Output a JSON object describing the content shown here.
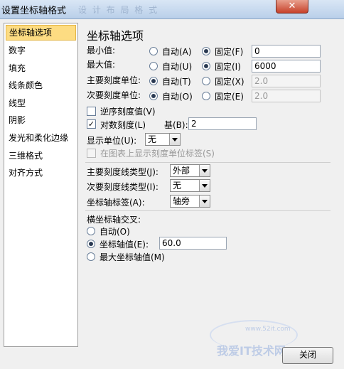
{
  "window": {
    "title": "设置坐标轴格式",
    "ghost_text": "设 计   布 局   格 式"
  },
  "sidebar": {
    "items": [
      {
        "label": "坐标轴选项",
        "selected": true
      },
      {
        "label": "数字"
      },
      {
        "label": "填充"
      },
      {
        "label": "线条颜色"
      },
      {
        "label": "线型"
      },
      {
        "label": "阴影"
      },
      {
        "label": "发光和柔化边缘"
      },
      {
        "label": "三维格式"
      },
      {
        "label": "对齐方式"
      }
    ]
  },
  "panel": {
    "heading": "坐标轴选项",
    "min": {
      "label": "最小值:",
      "auto": "自动(A)",
      "fixed": "固定(F)",
      "value": "0"
    },
    "max": {
      "label": "最大值:",
      "auto": "自动(U)",
      "fixed": "固定(I)",
      "value": "6000"
    },
    "major": {
      "label": "主要刻度单位:",
      "auto": "自动(T)",
      "fixed": "固定(X)",
      "value": "2.0"
    },
    "minor": {
      "label": "次要刻度单位:",
      "auto": "自动(O)",
      "fixed": "固定(E)",
      "value": "2.0"
    },
    "reverse": {
      "label": "逆序刻度值(V)",
      "checked": false
    },
    "log": {
      "label": "对数刻度(L)",
      "checked": true,
      "base_label": "基(B):",
      "base_value": "2"
    },
    "display_units": {
      "label": "显示单位(U):",
      "value": "无"
    },
    "show_units_label": {
      "label": "在图表上显示刻度单位标签(S)"
    },
    "major_tick_type": {
      "label": "主要刻度线类型(J):",
      "value": "外部"
    },
    "minor_tick_type": {
      "label": "次要刻度线类型(I):",
      "value": "无"
    },
    "axis_labels": {
      "label": "坐标轴标签(A):",
      "value": "轴旁"
    },
    "cross": {
      "label": "横坐标轴交叉:",
      "auto": "自动(O)",
      "value_option": "坐标轴值(E):",
      "value": "60.0",
      "max_option": "最大坐标轴值(M)"
    }
  },
  "footer": {
    "close_label": "关闭"
  },
  "watermark": {
    "text": "我爱IT技术网",
    "url": "www.52it.com"
  }
}
